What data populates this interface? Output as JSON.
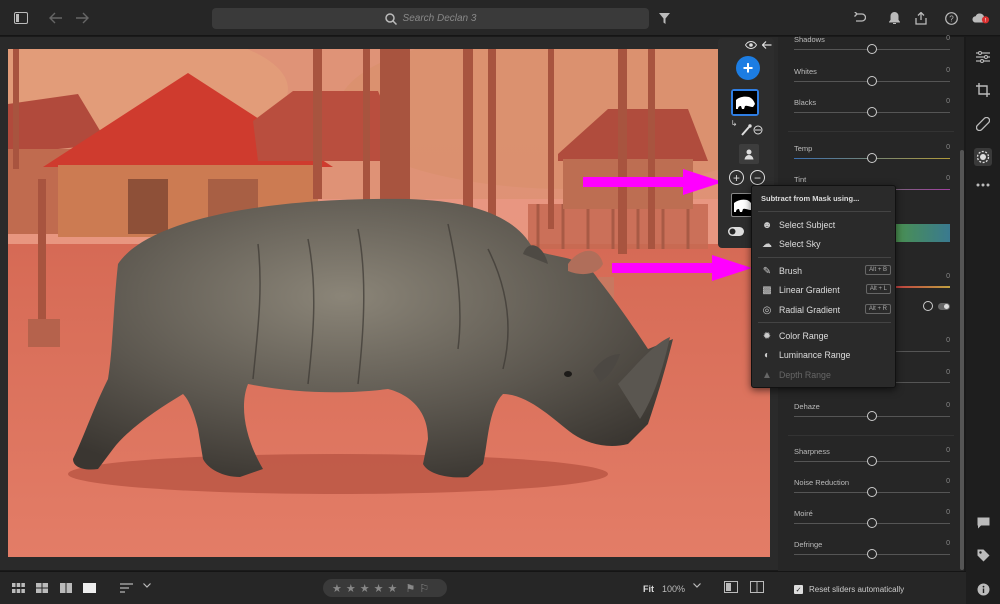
{
  "topbar": {
    "search_placeholder": "Search Declan 3",
    "icons": [
      "sidebar-toggle-icon",
      "back-arrow-icon",
      "forward-arrow-icon",
      "search-icon",
      "filter-icon",
      "undo-icon",
      "bell-icon",
      "share-icon",
      "help-icon",
      "cloud-icon"
    ]
  },
  "dropdown": {
    "title": "Subtract from Mask using...",
    "items": [
      {
        "label": "Select Subject",
        "shortcut": ""
      },
      {
        "label": "Select Sky",
        "shortcut": ""
      },
      {
        "label": "Brush",
        "shortcut": "Alt + B"
      },
      {
        "label": "Linear Gradient",
        "shortcut": "Alt + L"
      },
      {
        "label": "Radial Gradient",
        "shortcut": "Alt + R"
      },
      {
        "label": "Color Range",
        "shortcut": ""
      },
      {
        "label": "Luminance Range",
        "shortcut": ""
      },
      {
        "label": "Depth Range",
        "shortcut": ""
      }
    ]
  },
  "panel": {
    "sliders": [
      {
        "name": "Shadows",
        "value": "0"
      },
      {
        "name": "Whites",
        "value": "0"
      },
      {
        "name": "Blacks",
        "value": "0"
      },
      {
        "name": "Temp",
        "value": "0"
      },
      {
        "name": "Tint",
        "value": "0"
      },
      {
        "name": "Dehaze",
        "value": "0"
      },
      {
        "name": "Sharpness",
        "value": "0"
      },
      {
        "name": "Noise Reduction",
        "value": "0"
      },
      {
        "name": "Moiré",
        "value": "0"
      },
      {
        "name": "Defringe",
        "value": "0"
      }
    ],
    "hidden_values": [
      "0",
      "0",
      "0",
      "0",
      "0"
    ],
    "reset_label": "Reset sliders automatically"
  },
  "bottombar": {
    "fit_label": "Fit",
    "zoom_label": "100%"
  },
  "colors": {
    "accent": "#1c7de3",
    "annotation_arrow": "#ff00ff",
    "mask_overlay": "#e8604c"
  }
}
